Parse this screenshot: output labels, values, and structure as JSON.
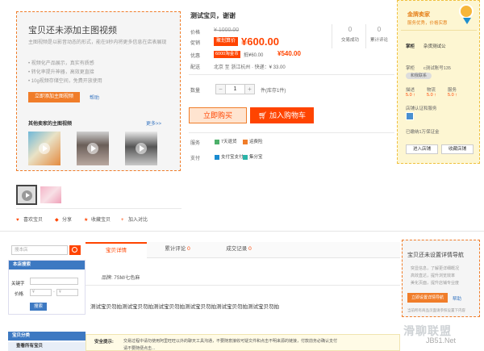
{
  "video_promo": {
    "title": "宝贝还未添加主图视频",
    "description": "主图视频是以影音动态的形式，能在9秒内将更多信息在店表展现",
    "bullets": [
      "视频化产品展示，真实有质感",
      "转化率提升神器，高效更直接",
      "10g视频存储空间，免费开放使用"
    ],
    "add_button": "立即添加主图视频",
    "help_link": "帮助",
    "other_videos_label": "其他卖家的主图视频",
    "more_link": "更多>>"
  },
  "actions": {
    "favorite_item": "喜欢宝贝",
    "share": "分享",
    "favorite_store": "收藏宝贝",
    "add_compare": "加入对比"
  },
  "product": {
    "title": "测试宝贝，谢谢",
    "price_label": "价格",
    "original_price": "¥ 1000.00",
    "promo_label": "促销",
    "promo_badge": "聚划算价",
    "promo_price": "¥600.00",
    "discount_label": "优惠",
    "discount_badge": "6000淘金币",
    "discount_text": "抵¥60.00",
    "discount_price": "¥540.00",
    "ship_label": "配送",
    "ship_text": "北京  至  浙江杭州 · 快递：¥ 33.00",
    "sold_count": "0",
    "sold_label": "交易成功",
    "review_count": "0",
    "review_label": "累计评论",
    "qty_label": "数量",
    "qty_value": "1",
    "qty_minus": "−",
    "qty_plus": "+",
    "qty_unit": "件(库存1件)",
    "buy_now": "立即购买",
    "add_cart": "加入购物车",
    "service_label": "服务",
    "service_1": "7天退货",
    "service_2": "运费险",
    "pay_label": "支付",
    "pay_1": "支付宝支付",
    "pay_2": "集分宝"
  },
  "seller": {
    "badge": "金牌卖家",
    "badge_sub": "服务优秀，价格实惠",
    "name_label": "掌柜",
    "name_value": "杂货测试公",
    "account_label": "掌柜",
    "account_value": "c测试账号135",
    "ww": "和我联系",
    "ratings_labels": [
      "描述",
      "物流",
      "服务"
    ],
    "ratings_values": [
      "5.0 ↑",
      "5.0 ↑",
      "5.0 ↑"
    ],
    "cert_label": "店铺认证和服务",
    "deposit": "已缴纳1万保证金",
    "enter_store": "进入店铺",
    "fav_store": "收藏店铺"
  },
  "sidebar": {
    "search_placeholder": "搜本店",
    "store_search_head": "本店搜索",
    "keyword_label": "关键字",
    "price_label": "价格",
    "price_from": "¥",
    "price_to": "¥",
    "search_btn": "搜索",
    "category_head": "宝贝分类",
    "view_all": "查看所有宝贝"
  },
  "tabs": {
    "detail": "宝贝详情",
    "reviews": "累计评论",
    "reviews_count": "0",
    "records": "成交记录",
    "records_count": "0"
  },
  "detail": {
    "brand_line": "品牌: 7SM/七色麻",
    "desc": "测试宝贝勿拍测试宝贝勿拍测试宝贝勿拍测试宝贝勿拍测试宝贝勿拍测试宝贝勿拍",
    "safety_label": "安全提示:",
    "safety_text": "交易过程中请勿使用阿里旺旺以外的聊天工具沟通，不要随意接收可疑文件和点击不明来源的链接，付款前务必确认支付",
    "safety_text_2": "请不要随便点击..."
  },
  "nav_guide": {
    "title": "宝贝还未设置详情导航",
    "bullets": [
      "突显信息，了解更详细概况",
      "高效直达，提升浏览效率",
      "美化页面，提升店铺专业度"
    ],
    "button": "立即设置详情导航",
    "help": "帮助",
    "note": "当前所有商品页面请参照设置下内容"
  },
  "watermark": {
    "main": "滑聊联盟",
    "sub": "JB51.Net"
  }
}
